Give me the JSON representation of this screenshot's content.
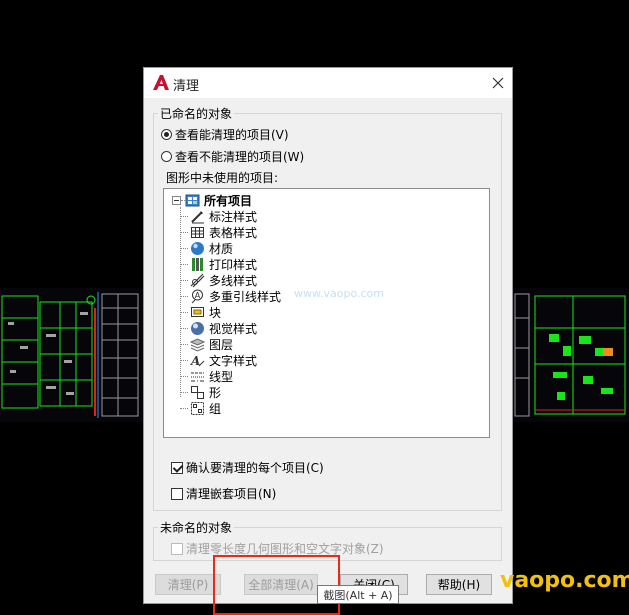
{
  "dialog": {
    "title": "清理",
    "named_group_label": "已命名的对象",
    "radio_view_purgeable": "查看能清理的项目(V)",
    "radio_view_unpurgeable": "查看不能清理的项目(W)",
    "tree_label": "图形中未使用的项目:",
    "tree": {
      "root": "所有项目",
      "items": [
        {
          "label": "标注样式",
          "icon": "dimension-style-icon"
        },
        {
          "label": "表格样式",
          "icon": "table-style-icon"
        },
        {
          "label": "材质",
          "icon": "material-icon"
        },
        {
          "label": "打印样式",
          "icon": "plot-style-icon"
        },
        {
          "label": "多线样式",
          "icon": "multiline-style-icon"
        },
        {
          "label": "多重引线样式",
          "icon": "multileader-style-icon"
        },
        {
          "label": "块",
          "icon": "block-icon"
        },
        {
          "label": "视觉样式",
          "icon": "visual-style-icon"
        },
        {
          "label": "图层",
          "icon": "layer-icon"
        },
        {
          "label": "文字样式",
          "icon": "text-style-icon"
        },
        {
          "label": "线型",
          "icon": "linetype-icon"
        },
        {
          "label": "形",
          "icon": "shape-icon"
        },
        {
          "label": "组",
          "icon": "group-icon"
        }
      ]
    },
    "check_confirm_each": "确认要清理的每个项目(C)",
    "check_nested": "清理嵌套项目(N)",
    "unnamed_group_label": "未命名的对象",
    "check_zero_length": "清理零长度几何图形和空文字对象(Z)",
    "buttons": {
      "purge": "清理(P)",
      "purge_all": "全部清理(A)",
      "close": "关闭(C)",
      "help": "帮助(H)"
    }
  },
  "tooltip": "截图(Alt + A)",
  "watermark": "vaopo.com",
  "faint_watermark": "www.vaopo.com",
  "colors": {
    "accent_red": "#e8291c",
    "watermark_yellow": "#f2c10f",
    "cad_green": "#19e619"
  }
}
